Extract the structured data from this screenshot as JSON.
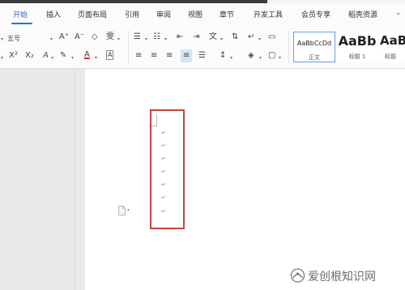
{
  "tabs": {
    "home": "开始",
    "insert": "插入",
    "layout": "页面布局",
    "reference": "引用",
    "review": "审阅",
    "view": "视图",
    "section": "章节",
    "developer": "开发工具",
    "member": "会员专享",
    "resources": "稻壳资源"
  },
  "ribbon": {
    "font_size": "五号",
    "grow_font": "A⁺",
    "shrink_font": "A⁻",
    "clear_format": "◇",
    "phonetic": "雯",
    "superscript": "X²",
    "subscript": "X₂",
    "text_effect": "A",
    "highlight": "✎",
    "font_color": "A",
    "char_border": "A",
    "bullets": "☰",
    "numbering": "☷",
    "outdent": "⇤",
    "indent": "⇥",
    "chinese_layout": "文",
    "sort": "⇅",
    "show_marks": "↵",
    "borders": "▭",
    "align_left": "≡",
    "align_center": "≡",
    "align_right": "≡",
    "justify": "≡",
    "distribute": "☰",
    "line_spacing": "↕",
    "shading": "◈",
    "para_border": "▢",
    "dropdown": "▾"
  },
  "styles": [
    {
      "sample": "AaBbCcDd",
      "name": "正文"
    },
    {
      "sample": "AaBb",
      "name": "标题 1"
    },
    {
      "sample": "AaB",
      "name": "标题"
    }
  ],
  "document": {
    "paragraph_mark": "↵",
    "mark_count": 7
  },
  "watermark": {
    "text": "爱创根知识网"
  },
  "colors": {
    "accent": "#2f6bd9",
    "highlight_border": "#c9413a",
    "font_color_bar": "#e02020"
  }
}
